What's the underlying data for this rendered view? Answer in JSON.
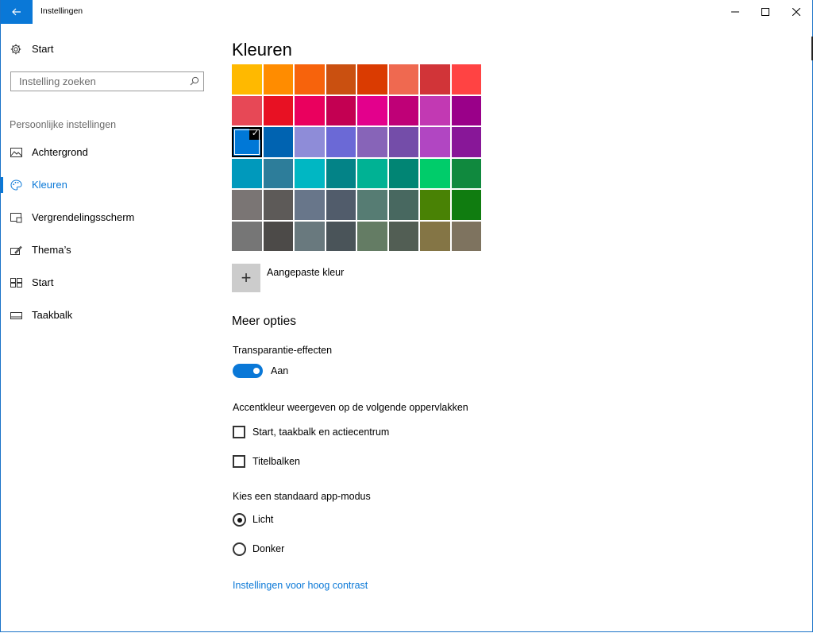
{
  "window": {
    "title": "Instellingen",
    "back_icon": "arrow-left-icon",
    "accent": "#0a78d7"
  },
  "sidebar": {
    "home_label": "Start",
    "search_placeholder": "Instelling zoeken",
    "section_label": "Persoonlijke instellingen",
    "items": [
      {
        "label": "Achtergrond",
        "icon": "picture-icon"
      },
      {
        "label": "Kleuren",
        "icon": "palette-icon",
        "active": true
      },
      {
        "label": "Vergrendelingsscherm",
        "icon": "lock-screen-icon"
      },
      {
        "label": "Thema’s",
        "icon": "theme-brush-icon"
      },
      {
        "label": "Start",
        "icon": "start-tiles-icon"
      },
      {
        "label": "Taakbalk",
        "icon": "taskbar-icon"
      }
    ]
  },
  "main": {
    "title": "Kleuren",
    "swatch_colors": [
      "#ffb900",
      "#ff8c00",
      "#f7630c",
      "#ca5010",
      "#da3b01",
      "#ef6950",
      "#d13438",
      "#ff4343",
      "#e74856",
      "#e81123",
      "#ea005e",
      "#c30052",
      "#e3008c",
      "#bf0077",
      "#c239b3",
      "#9a0089",
      "#0078d7",
      "#0063b1",
      "#8e8cd8",
      "#6b69d6",
      "#8764b8",
      "#744da9",
      "#b146c2",
      "#881798",
      "#0099bc",
      "#2d7d9a",
      "#00b7c3",
      "#038387",
      "#00b294",
      "#018574",
      "#00cc6a",
      "#10893e",
      "#7a7574",
      "#5d5a58",
      "#68768a",
      "#515c6b",
      "#567c73",
      "#486860",
      "#498205",
      "#107c10",
      "#767676",
      "#4c4a48",
      "#69797e",
      "#4a5459",
      "#647c64",
      "#525e54",
      "#847545",
      "#7e735f"
    ],
    "selected_swatch_index": 16,
    "custom_color_label": "Aangepaste kleur",
    "more_options_heading": "Meer opties",
    "transparency_label": "Transparantie-effecten",
    "transparency_state": "Aan",
    "accent_surfaces_label": "Accentkleur weergeven op de volgende oppervlakken",
    "checkbox_start": "Start, taakbalk en actiecentrum",
    "checkbox_titlebars": "Titelbalken",
    "app_mode_label": "Kies een standaard app-modus",
    "radio_light": "Licht",
    "radio_dark": "Donker",
    "selected_mode": "Licht",
    "high_contrast_link": "Instellingen voor hoog contrast"
  }
}
